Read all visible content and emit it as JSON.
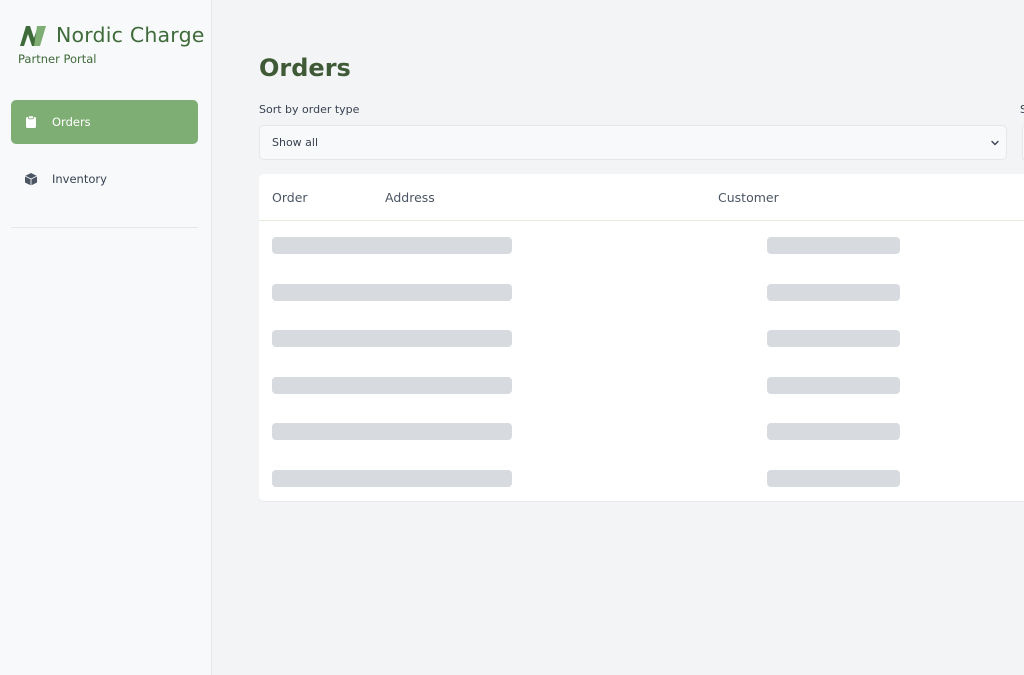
{
  "brand": {
    "name": "Nordic Charge",
    "subtitle": "Partner Portal",
    "color": "#3f6b3a",
    "logo_icon": "lightning-n-icon"
  },
  "nav": {
    "items": [
      {
        "label": "Orders",
        "icon": "clipboard-icon",
        "active": true
      },
      {
        "label": "Inventory",
        "icon": "box-icon",
        "active": false
      }
    ],
    "active_color": "#7eae73"
  },
  "main": {
    "title": "Orders",
    "filter": {
      "label": "Sort by order type",
      "value": "Show all"
    },
    "second_filter_label": "S",
    "table": {
      "columns": [
        "Order",
        "Address",
        "Customer"
      ],
      "loading_rows": 6
    }
  }
}
